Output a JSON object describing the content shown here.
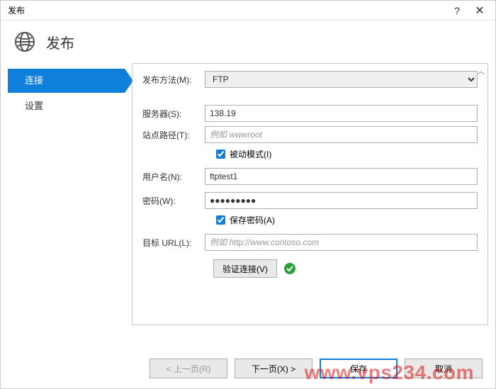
{
  "window": {
    "title": "发布",
    "help": "?",
    "close": "✕"
  },
  "header": {
    "title": "发布"
  },
  "sidebar": {
    "items": [
      {
        "label": "连接",
        "active": true
      },
      {
        "label": "设置",
        "active": false
      }
    ]
  },
  "form": {
    "method_label": "发布方法(M):",
    "method_value": "FTP",
    "server_label": "服务器(S):",
    "server_value": "138.19",
    "sitepath_label": "站点路径(T):",
    "sitepath_placeholder": "例如 wwwroot",
    "sitepath_value": "",
    "passive_label": "被动模式(I)",
    "passive_checked": true,
    "user_label": "用户名(N):",
    "user_value": "ftptest1",
    "pwd_label": "密码(W):",
    "pwd_value": "●●●●●●●●●",
    "savepwd_label": "保存密码(A)",
    "savepwd_checked": true,
    "targeturl_label": "目标 URL(L):",
    "targeturl_placeholder": "例如 http://www.contoso.com",
    "targeturl_value": "",
    "verify_label": "验证连接(V)"
  },
  "footer": {
    "prev": "< 上一页(R)",
    "next": "下一页(X) >",
    "save": "保存",
    "cancel": "取消"
  },
  "watermark": {
    "text": "www.vps234.com"
  }
}
